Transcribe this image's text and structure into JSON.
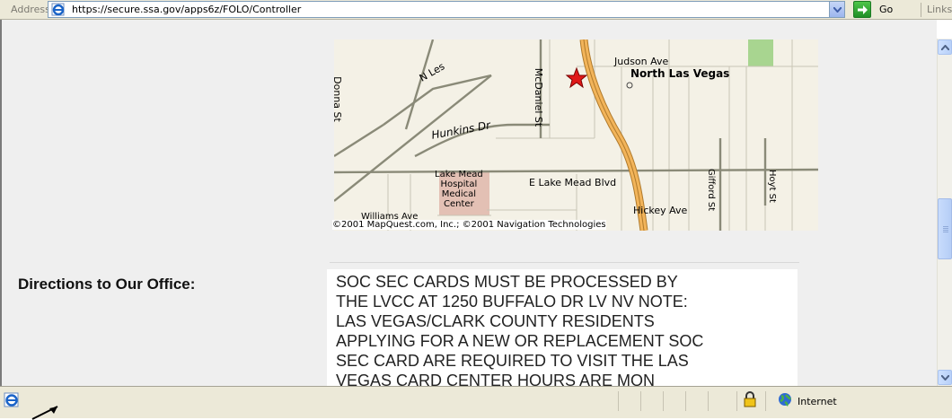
{
  "address_bar": {
    "label": "Address",
    "url": "https://secure.ssa.gov/apps6z/FOLO/Controller",
    "go_label": "Go",
    "links_label": "Links"
  },
  "map": {
    "labels": {
      "judson": "Judson Ave",
      "north_las_vegas": "North Las Vegas",
      "donna": "Donna St",
      "nles": "N Les",
      "mcdaniel": "McDaniel St",
      "hunkins": "Hunkins Dr",
      "lake_mead_hospital": [
        "Lake Mead",
        "Hospital",
        "Medical",
        "Center"
      ],
      "e_lake_mead": "E Lake Mead Blvd",
      "gifford": "Gifford St",
      "hoyt": "Hoyt St",
      "hickey": "Hickey Ave",
      "williams": "Williams Ave"
    },
    "copyright": "©2001 MapQuest.com, Inc.; ©2001 Navigation Technologies"
  },
  "directions": {
    "heading": "Directions to Our Office:",
    "lines": [
      "SOC SEC CARDS MUST BE PROCESSED BY",
      "THE LVCC AT 1250 BUFFALO DR LV NV NOTE:",
      "LAS VEGAS/CLARK COUNTY RESIDENTS",
      "APPLYING FOR A NEW OR REPLACEMENT SOC",
      "SEC CARD ARE REQUIRED TO VISIT THE LAS",
      "VEGAS CARD CENTER HOURS ARE MON"
    ]
  },
  "status_bar": {
    "zone": "Internet"
  },
  "colors": {
    "highway": "#f2b45a",
    "road": "#8a8a78",
    "hospital": "#e3c0b4",
    "park": "#a8d590",
    "marker": "#e01818"
  }
}
